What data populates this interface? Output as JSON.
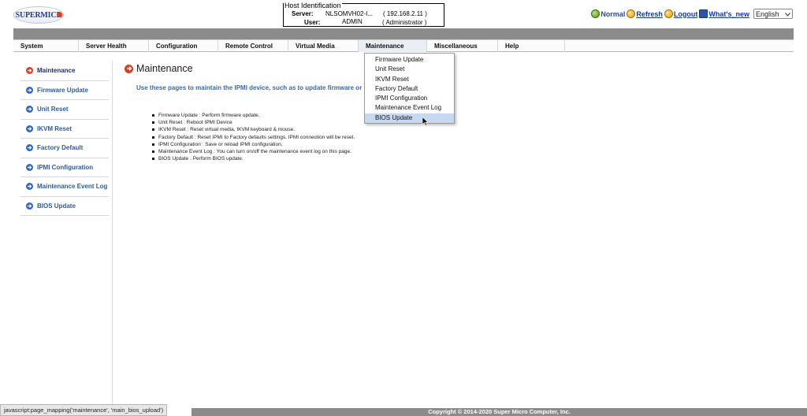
{
  "brand": {
    "logo_text": "SUPERMICR"
  },
  "host": {
    "legend": "Host Identification",
    "server_label": "Server:",
    "server_value": "NLSOMVH02-I...",
    "server_ip": "( 192.168.2.11 )",
    "user_label": "User:",
    "user_value": "ADMIN",
    "user_role": "( Administrator )"
  },
  "topbar": {
    "normal": "Normal",
    "refresh": "Refresh",
    "logout": "Logout",
    "whats_new": "What's_new",
    "language": "English"
  },
  "nav": {
    "tabs": [
      {
        "label": "System"
      },
      {
        "label": "Server Health"
      },
      {
        "label": "Configuration"
      },
      {
        "label": "Remote Control"
      },
      {
        "label": "Virtual Media"
      },
      {
        "label": "Maintenance"
      },
      {
        "label": "Miscellaneous"
      },
      {
        "label": "Help"
      }
    ]
  },
  "dropdown": {
    "items": [
      {
        "label": "Firmware Update"
      },
      {
        "label": "Unit Reset"
      },
      {
        "label": "IKVM Reset"
      },
      {
        "label": "Factory Default"
      },
      {
        "label": "IPMI Configuration"
      },
      {
        "label": "Maintenance Event Log"
      },
      {
        "label": "BIOS Update"
      }
    ],
    "highlighted": "BIOS Update"
  },
  "sidebar": {
    "items": [
      {
        "label": "Maintenance"
      },
      {
        "label": "Firmware Update"
      },
      {
        "label": "Unit Reset"
      },
      {
        "label": "IKVM Reset"
      },
      {
        "label": "Factory Default"
      },
      {
        "label": "IPMI Configuration"
      },
      {
        "label": "Maintenance Event Log"
      },
      {
        "label": "BIOS Update"
      }
    ]
  },
  "main": {
    "title": "Maintenance",
    "intro": "Use these pages to maintain the IPMI device, such as to update firmware or",
    "bullets": [
      "Firmware Update : Perform firmware update.",
      "Unit Reset : Reboot IPMI Device",
      "IKVM Reset : Reset virtual media, IKVM keyboard & mouse.",
      "Factory Default : Reset IPMI to Factory defaults settings. IPMI connection will be reset.",
      "IPMI Configuration : Save or reload IPMI configuration.",
      "Maintenance Event Log : You can turn on/off the maintenance event log on this page.",
      "BIOS Update : Perform BIOS update."
    ]
  },
  "footer": {
    "copyright": "Copyright © 2014-2020 Super Micro Computer, Inc."
  },
  "statusbar": {
    "text": "javascript:page_mapping('maintenance', 'main_bios_upload')"
  },
  "colors": {
    "accent_blue": "#2e66c5",
    "accent_red": "#e13a22",
    "bar_gray": "#8b8b8b",
    "highlight": "#c7d9f2"
  }
}
